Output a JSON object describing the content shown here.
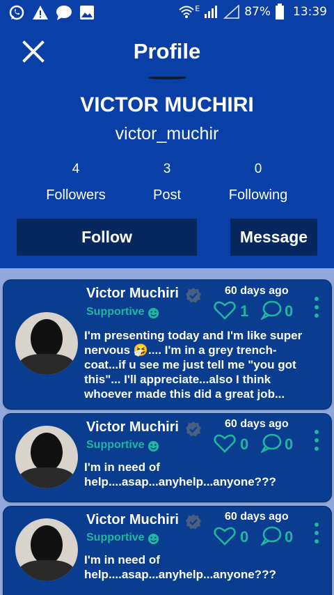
{
  "status_bar": {
    "battery": "87%",
    "time": "13:39",
    "network": "E",
    "icons": [
      "whatsapp-icon",
      "warning-icon",
      "chat-bubble-icon",
      "gallery-icon",
      "wifi-icon",
      "signal-icon",
      "battery-icon"
    ]
  },
  "header": {
    "title": "Profile",
    "name": "VICTOR MUCHIRI",
    "username": "victor_muchir",
    "stats": [
      {
        "value": "4",
        "label": "Followers"
      },
      {
        "value": "3",
        "label": "Post"
      },
      {
        "value": "0",
        "label": "Following"
      }
    ],
    "follow_label": "Follow",
    "message_label": "Message"
  },
  "posts": [
    {
      "author": "Victor Muchiri",
      "tag": "Supportive",
      "time": "60 days ago",
      "likes": "1",
      "comments": "0",
      "text": "I'm presenting today and I'm like super nervous 🤧.... I'm in a grey trench-coat...if u see me just tell me \"you got this\"... I'll appreciate...also I think whoever made this did a great job..."
    },
    {
      "author": "Victor Muchiri",
      "tag": "Supportive",
      "time": "60 days ago",
      "likes": "0",
      "comments": "0",
      "text": "I'm in need of help....asap...anyhelp...anyone???"
    },
    {
      "author": "Victor Muchiri",
      "tag": "Supportive",
      "time": "60 days ago",
      "likes": "0",
      "comments": "0",
      "text": "I'm in need of help....asap...anyhelp...anyone???"
    }
  ],
  "colors": {
    "header_bg": "#0a3fa8",
    "button_bg": "#06285e",
    "card_bg": "#0a3c8f",
    "accent": "#1eb7a0",
    "page_bg": "#8fa9dc"
  }
}
